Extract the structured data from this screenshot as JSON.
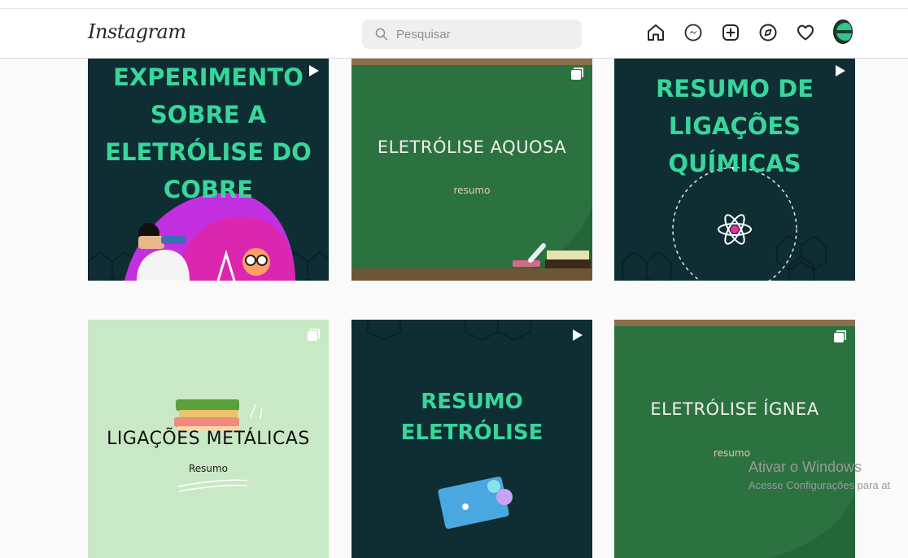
{
  "header": {
    "logo": "Instagram",
    "search_placeholder": "Pesquisar"
  },
  "nav_icons": [
    "home-icon",
    "messenger-icon",
    "new-post-icon",
    "explore-icon",
    "activity-heart-icon",
    "profile-avatar"
  ],
  "posts": [
    {
      "title_lines": [
        "EXPERIMENTO",
        "SOBRE A",
        "ELETRÓLISE DO",
        "COBRE"
      ],
      "badge": "reel-icon"
    },
    {
      "title": "ELETRÓLISE AQUOSA",
      "subtitle": "resumo",
      "badge": "carousel-icon"
    },
    {
      "title_lines": [
        "RESUMO DE",
        "LIGAÇÕES",
        "QUÍMICAS"
      ],
      "badge": "reel-icon"
    },
    {
      "title": "LIGAÇÕES METÁLICAS",
      "subtitle": "Resumo",
      "badge": "carousel-icon"
    },
    {
      "title_lines": [
        "RESUMO",
        "ELETRÓLISE"
      ],
      "badge": "reel-icon"
    },
    {
      "title": "ELETRÓLISE ÍGNEA",
      "subtitle": "resumo",
      "badge": "carousel-icon"
    }
  ],
  "watermark": {
    "line1": "Ativar o Windows",
    "line2": "Acesse Configurações para at"
  },
  "colors": {
    "dark_bg": "#0f2e33",
    "accent_green": "#38d69b",
    "board_green": "#2c7241",
    "light_green": "#c9e8c5"
  }
}
